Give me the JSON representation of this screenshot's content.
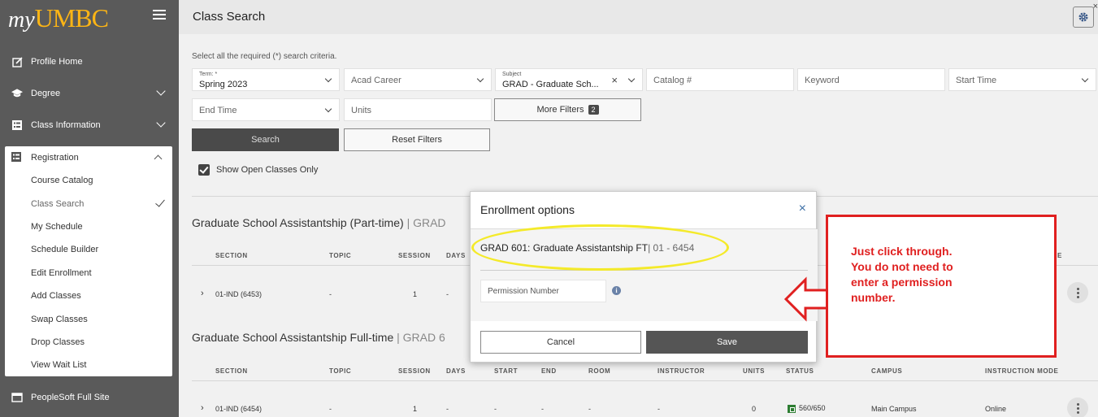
{
  "app": {
    "logo_my": "my",
    "logo_umbc": "UMBC",
    "page_title": "Class Search"
  },
  "sidebar": {
    "items": [
      {
        "label": "Profile Home",
        "icon": "edit-icon"
      },
      {
        "label": "Degree",
        "icon": "graduation-cap-icon"
      },
      {
        "label": "Class Information",
        "icon": "list-icon"
      }
    ],
    "registration": {
      "label": "Registration",
      "icon": "list-alt-icon",
      "sub_items": [
        {
          "label": "Course Catalog"
        },
        {
          "label": "Class Search",
          "active": true
        },
        {
          "label": "My Schedule"
        },
        {
          "label": "Schedule Builder"
        },
        {
          "label": "Edit Enrollment"
        },
        {
          "label": "Add Classes"
        },
        {
          "label": "Swap Classes"
        },
        {
          "label": "Drop Classes"
        },
        {
          "label": "View Wait List"
        }
      ]
    },
    "footer_item": {
      "label": "PeopleSoft Full Site",
      "icon": "window-icon"
    }
  },
  "search": {
    "criteria_note": "Select all the required (*) search criteria.",
    "term_label": "Term: *",
    "term_value": "Spring 2023",
    "acad_career": "Acad Career",
    "subject_label": "Subject",
    "subject_value": "GRAD - Graduate Sch...",
    "catalog": "Catalog #",
    "keyword": "Keyword",
    "start_time": "Start Time",
    "end_time": "End Time",
    "units": "Units",
    "more_filters": "More Filters",
    "more_filters_count": "2",
    "search_btn": "Search",
    "reset_btn": "Reset Filters",
    "open_only": "Show Open Classes Only"
  },
  "results": {
    "section1": {
      "title": "Graduate School Assistantship (Part-time)",
      "code": "| GRAD"
    },
    "section2": {
      "title": "Graduate School Assistantship Full-time",
      "code": "| GRAD 6"
    },
    "headers1": [
      "SECTION",
      "TOPIC",
      "SESSION",
      "DAYS"
    ],
    "header1_tail": "E",
    "headers2": [
      "SECTION",
      "TOPIC",
      "SESSION",
      "DAYS",
      "START",
      "END",
      "ROOM",
      "INSTRUCTOR",
      "UNITS",
      "STATUS",
      "CAMPUS",
      "INSTRUCTION MODE"
    ],
    "row1": {
      "section": "01-IND (6453)",
      "topic": "-",
      "session": "1",
      "days": "-"
    },
    "row2": {
      "section": "01-IND (6454)",
      "topic": "-",
      "session": "1",
      "days": "-",
      "start": "-",
      "end": "-",
      "room": "-",
      "instructor": "-",
      "units": "0",
      "status": "560/650",
      "campus": "Main Campus",
      "mode": "Online"
    }
  },
  "modal": {
    "title": "Enrollment options",
    "close": "×",
    "course": "GRAD 601: Graduate Assistantship FT",
    "course_suffix": "| 01 - 6454",
    "permission_placeholder": "Permission Number",
    "info": "i",
    "cancel": "Cancel",
    "save": "Save"
  },
  "annotation": {
    "text": "Just click through. You do not need to enter a permission number.",
    "ellipse_color": "#f4ea2a",
    "callout_color": "#e02020"
  }
}
